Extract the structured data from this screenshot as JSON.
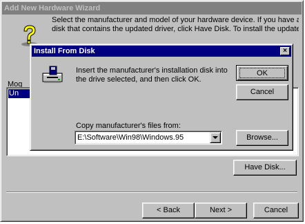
{
  "wizard": {
    "title": "Add New Hardware Wizard",
    "instruction_line1": "Select the manufacturer and model of your hardware device. If you have a",
    "instruction_line2": "disk that contains the updated driver, click Have Disk. To install the updated",
    "models_label": "Mog",
    "selected_item": "Un",
    "have_disk_label": "Have Disk...",
    "back_label": "< Back",
    "next_label": "Next >",
    "cancel_label": "Cancel"
  },
  "dialog": {
    "title": "Install From Disk",
    "close_glyph": "×",
    "message": "Insert the manufacturer's installation disk into the drive selected, and then click OK.",
    "ok_label": "OK",
    "cancel_label": "Cancel",
    "copy_label": "Copy manufacturer's files from:",
    "path_value": "E:\\Software\\Win98\\Windows.95",
    "browse_label": "Browse..."
  },
  "icons": {
    "wizard_icon": "question-mark-icon",
    "disk_icon": "disk-drive-icon"
  },
  "colors": {
    "active_title": "#000080",
    "inactive_title": "#808080",
    "face": "#c0c0c0",
    "selection": "#000080"
  }
}
